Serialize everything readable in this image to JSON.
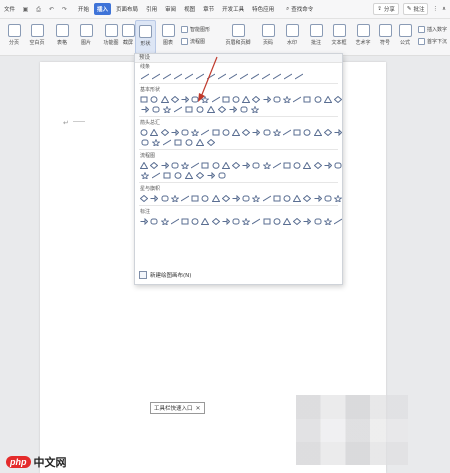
{
  "menu": {
    "file_label": "文件",
    "tabs": [
      "开始",
      "插入",
      "页面布局",
      "引用",
      "审阅",
      "视图",
      "章节",
      "开发工具",
      "特色应用"
    ],
    "active_tab": "插入",
    "search_label": "查找命令",
    "share_label": "分享",
    "comment_label": "批注"
  },
  "ribbon": {
    "items": [
      {
        "label": "分页",
        "key": "page-break"
      },
      {
        "label": "空白页",
        "key": "blank-page"
      },
      {
        "label": "表格",
        "key": "table"
      },
      {
        "label": "图片",
        "key": "picture"
      },
      {
        "label": "功能图",
        "key": "function-chart"
      },
      {
        "label": "截屏",
        "key": "screenshot"
      },
      {
        "label": "形状",
        "key": "shapes"
      },
      {
        "label": "图表",
        "key": "chart"
      },
      {
        "label": "文本框",
        "key": "textbox"
      },
      {
        "label": "页眉和页脚",
        "key": "header-footer"
      },
      {
        "label": "页码",
        "key": "page-number"
      },
      {
        "label": "水印",
        "key": "watermark"
      },
      {
        "label": "批注",
        "key": "comment"
      },
      {
        "label": "文本框",
        "key": "textbox-2"
      },
      {
        "label": "艺术字",
        "key": "wordart"
      },
      {
        "label": "符号",
        "key": "symbol"
      },
      {
        "label": "公式",
        "key": "formula"
      }
    ],
    "small": {
      "smart_art": "智能图形",
      "flowchart": "流程图",
      "insert_number": "插入数字",
      "first_letter": "首字下沉"
    }
  },
  "shapes_panel": {
    "title": "预设",
    "sections": [
      {
        "label": "线条",
        "count": 15
      },
      {
        "label": "基本形状",
        "count": 31
      },
      {
        "label": "箭头总汇",
        "count": 27
      },
      {
        "label": "流程图",
        "count": 28
      },
      {
        "label": "星与旗帜",
        "count": 20
      },
      {
        "label": "标注",
        "count": 20
      }
    ],
    "new_canvas_label": "新建绘图画布(N)"
  },
  "floating_toolbar": {
    "label": "工具栏快速入口"
  },
  "watermark": {
    "logo_left": "php",
    "logo_right": "中文网"
  },
  "colors": {
    "accent": "#3e73d8",
    "annotation_arrow": "#c0392b",
    "logo_red": "#e42b2b"
  }
}
